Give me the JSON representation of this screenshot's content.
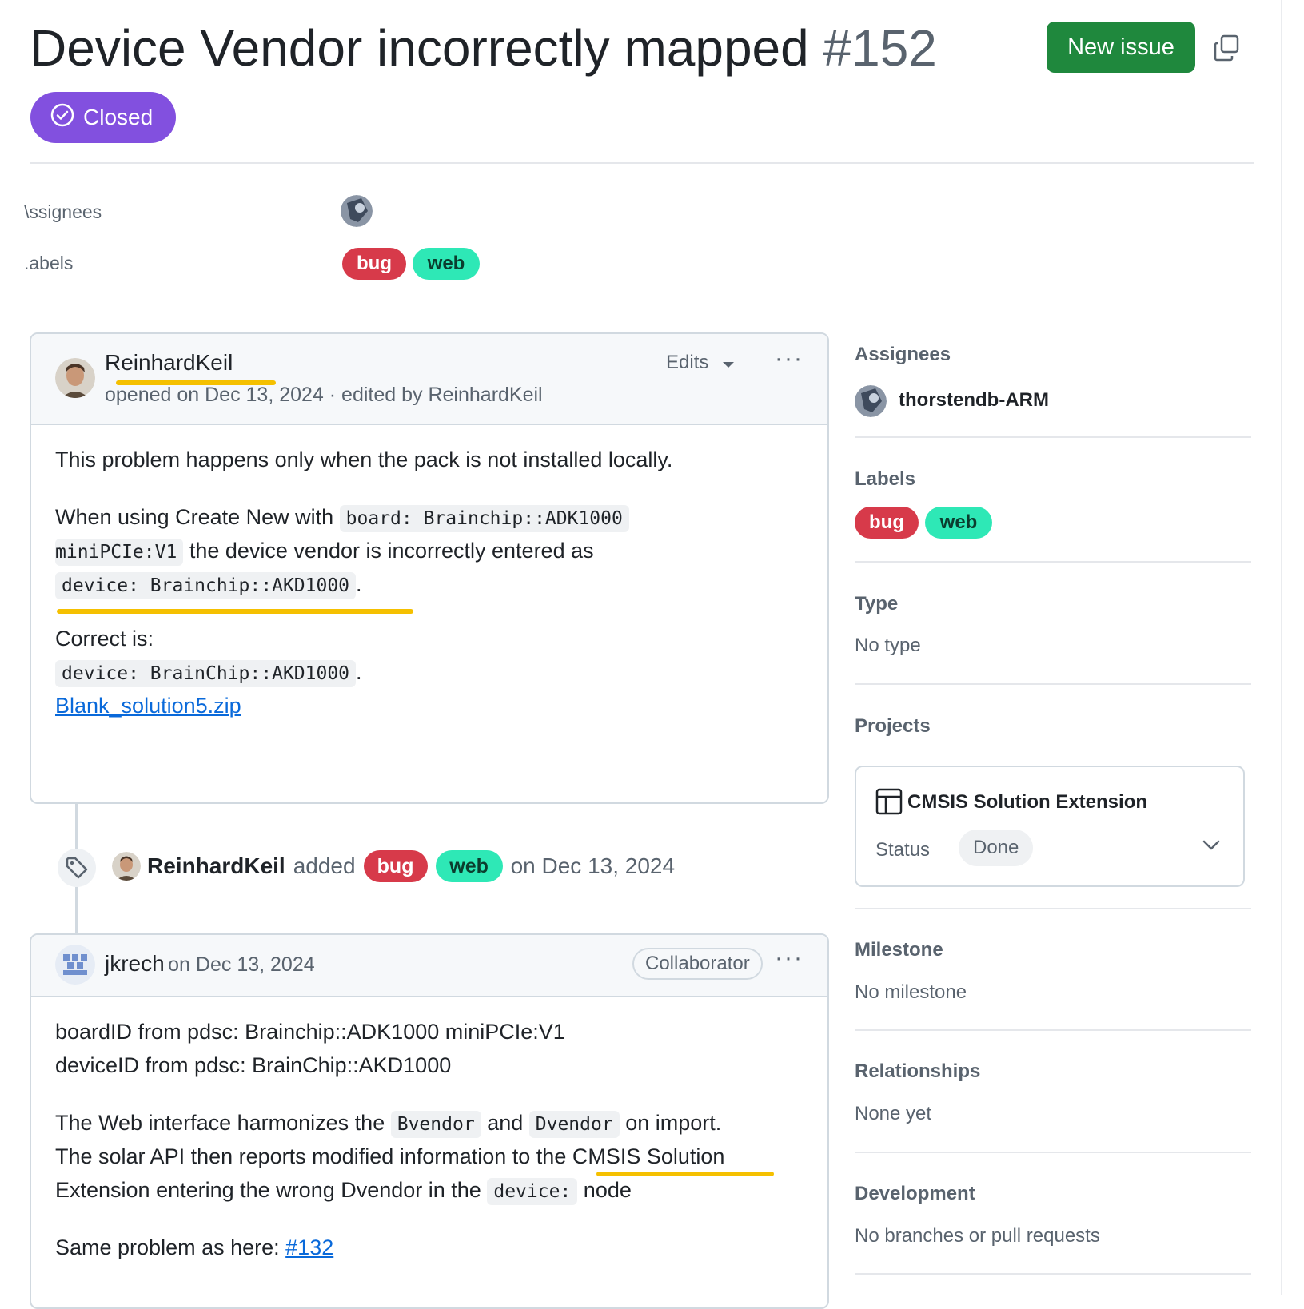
{
  "issue": {
    "title": "Device Vendor incorrectly mapped",
    "number": "#152",
    "state": "Closed",
    "new_issue_label": "New issue"
  },
  "meta": {
    "assignees_label": "\\ssignees",
    "labels_label": ".abels",
    "labels": [
      "bug",
      "web"
    ]
  },
  "comment1": {
    "author": "ReinhardKeil",
    "subline": "opened on Dec 13, 2024 · edited by ReinhardKeil",
    "edits_label": "Edits",
    "menu": "···",
    "p1": "This problem happens only when the pack is not installed locally.",
    "p2_a": "When using Create New with",
    "p2_code1": "board: Brainchip::ADK1000",
    "p2_code2": "miniPCIe:V1",
    "p2_b": "the device vendor is incorrectly entered as",
    "p2_code3": "device: Brainchip::AKD1000",
    "period": ".",
    "p3": "Correct is:",
    "p3_code": "device: BrainChip::AKD1000",
    "attachment": "Blank_solution5.zip"
  },
  "event": {
    "actor": "ReinhardKeil",
    "action": "added",
    "labels": [
      "bug",
      "web"
    ],
    "date": "on Dec 13, 2024"
  },
  "comment2": {
    "author": "jkrech",
    "date": "on Dec 13, 2024",
    "role": "Collaborator",
    "menu": "···",
    "l1": "boardID from pdsc: Brainchip::ADK1000 miniPCIe:V1",
    "l2": "deviceID from pdsc: BrainChip::AKD1000",
    "l3_a": "The Web interface harmonizes the",
    "l3_code1": "Bvendor",
    "l3_b": "and",
    "l3_code2": "Dvendor",
    "l3_c": "on import.",
    "l4": "The solar API then reports modified information to the CMSIS Solution",
    "l5_a": "Extension entering the wrong Dvendor in the",
    "l5_code": "device:",
    "l5_b": "node",
    "l6_a": "Same problem as here:",
    "l6_link": "#132"
  },
  "sidebar": {
    "assignees_title": "Assignees",
    "assignee": "thorstendb-ARM",
    "labels_title": "Labels",
    "labels": [
      "bug",
      "web"
    ],
    "type_title": "Type",
    "type_value": "No type",
    "projects_title": "Projects",
    "project_name": "CMSIS Solution Extension",
    "status_label": "Status",
    "status_value": "Done",
    "milestone_title": "Milestone",
    "milestone_value": "No milestone",
    "relationships_title": "Relationships",
    "relationships_value": "None yet",
    "development_title": "Development",
    "development_value": "No branches or pull requests"
  },
  "colors": {
    "closed_purple": "#8250df",
    "new_issue_green": "#1f883d",
    "bug_red": "#d73a4a",
    "web_teal": "#2ee8b6",
    "link_blue": "#0969da",
    "highlight_yellow": "#f5c000"
  }
}
